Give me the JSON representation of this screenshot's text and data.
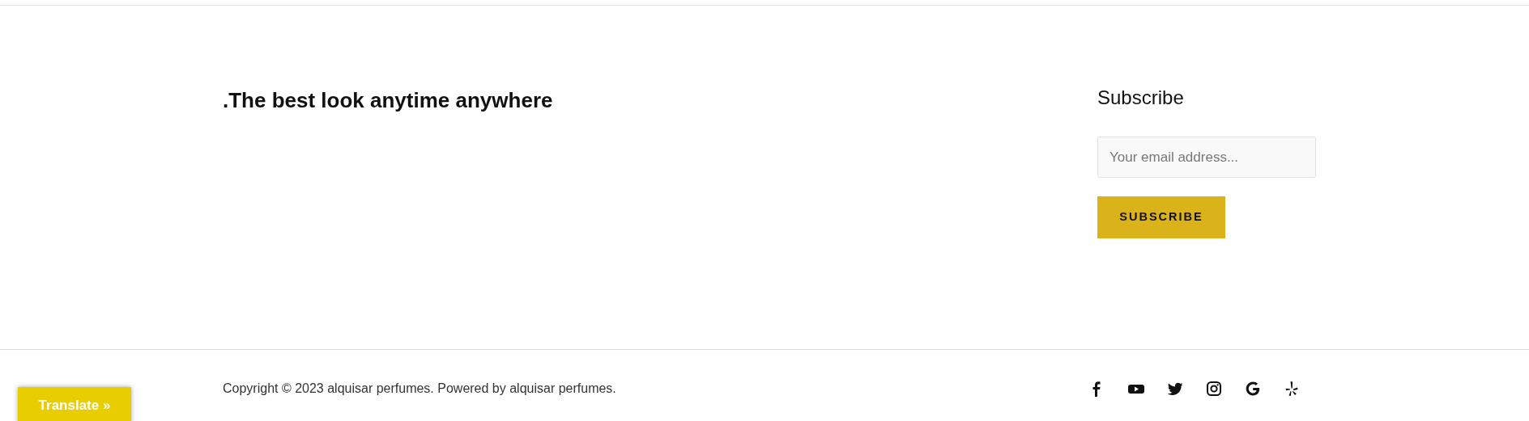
{
  "tagline": ".The best look anytime anywhere",
  "subscribe": {
    "title": "Subscribe",
    "placeholder": "Your email address...",
    "button": "SUBSCRIBE"
  },
  "footer": {
    "copyright": "Copyright © 2023 alquisar perfumes. Powered by alquisar perfumes."
  },
  "translate_button": "Translate »"
}
